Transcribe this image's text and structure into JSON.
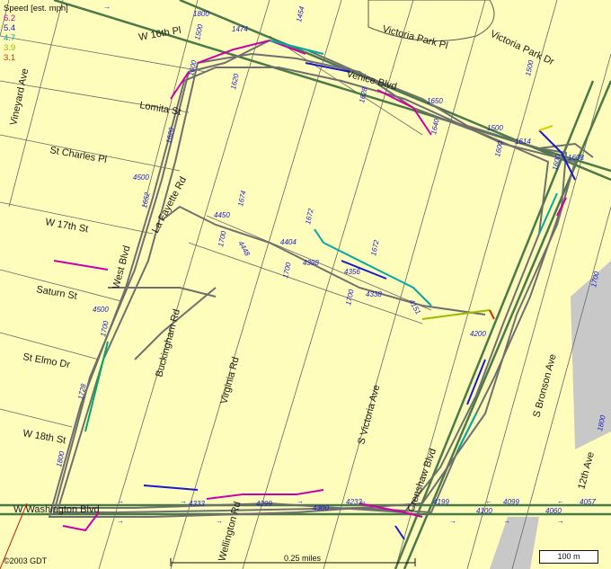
{
  "legend": {
    "title": "Speed [est. mph]",
    "items": [
      {
        "value": "6.2",
        "color": "#cc00aa"
      },
      {
        "value": "5.4",
        "color": "#1a1acc"
      },
      {
        "value": "4.7",
        "color": "#00a8a8"
      },
      {
        "value": "3.9",
        "color": "#99bb00"
      },
      {
        "value": "3.1",
        "color": "#cc3300"
      }
    ]
  },
  "streets": [
    "W 16th Pl",
    "Lomita St",
    "St Charles Pl",
    "W 17th St",
    "Saturn St",
    "St Elmo Dr",
    "W 18th St",
    "W Washington Blvd",
    "Vineyard Ave",
    "Victoria Park Pl",
    "Victoria Park Dr",
    "Venice Blvd",
    "La Fayette Rd",
    "West Blvd",
    "Buckingham Rd",
    "Virginia Rd",
    "S Victoria Ave",
    "S Bronson Ave",
    "12th Ave",
    "Wellington Rd",
    "Crenshaw Blvd"
  ],
  "addresses": [
    "1800",
    "1500",
    "1474",
    "1454",
    "1500",
    "1620",
    "1600",
    "1628",
    "1650",
    "1640",
    "1500",
    "1600",
    "1620",
    "1652",
    "4500",
    "1674",
    "4450",
    "4448",
    "1700",
    "4404",
    "1672",
    "4398",
    "4356",
    "1672",
    "4338",
    "1700",
    "1700",
    "4500",
    "1700",
    "1728",
    "1800",
    "4200",
    "1700",
    "1800",
    "4333",
    "4300",
    "4299",
    "4233",
    "4199",
    "4100",
    "4099",
    "4060",
    "4057",
    "4151",
    "1600",
    "1608",
    "1614"
  ],
  "scale": {
    "distance": "0.25 miles",
    "box": "100 m"
  },
  "copyright": "©2003 GDT",
  "colors": {
    "background": "#fefdbb",
    "track": "#707070",
    "major_road": "#4a7a4a"
  }
}
